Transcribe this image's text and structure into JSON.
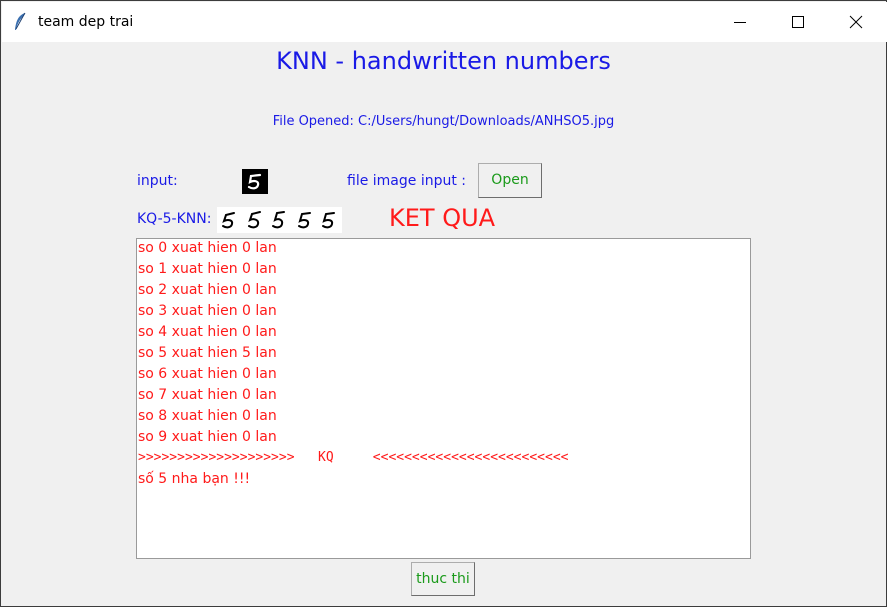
{
  "window": {
    "title": "team dep trai",
    "icon": "feather-icon",
    "controls": [
      "minimize-icon",
      "maximize-icon",
      "close-icon"
    ]
  },
  "heading": "KNN - handwritten numbers",
  "file_opened": "File Opened: C:/Users/hungt/Downloads/ANHSO5.jpg",
  "input_label": "input:",
  "file_image_label": "file image input :",
  "open_button": "Open",
  "kq_label": "KQ-5-KNN:",
  "ket_qua": "KET QUA",
  "result_lines": [
    "so 0 xuat hien 0 lan",
    "so 1 xuat hien 0 lan",
    "so 2 xuat hien 0 lan",
    "so 3 xuat hien 0 lan",
    "so 4 xuat hien 0 lan",
    "so 5 xuat hien 5 lan",
    "so 6 xuat hien 0 lan",
    "so 7 xuat hien 0 lan",
    "so 8 xuat hien 0 lan",
    "so 9 xuat hien 0 lan",
    ">>>>>>>>>>>>>>>>>>>>   KQ     <<<<<<<<<<<<<<<<<<<<<<<<<",
    "số 5 nha bạn !!!"
  ],
  "run_button": "thuc thi",
  "colors": {
    "label_blue": "#1a1ae6",
    "result_red": "#ff1a1a",
    "button_green": "#1a9a1a"
  }
}
